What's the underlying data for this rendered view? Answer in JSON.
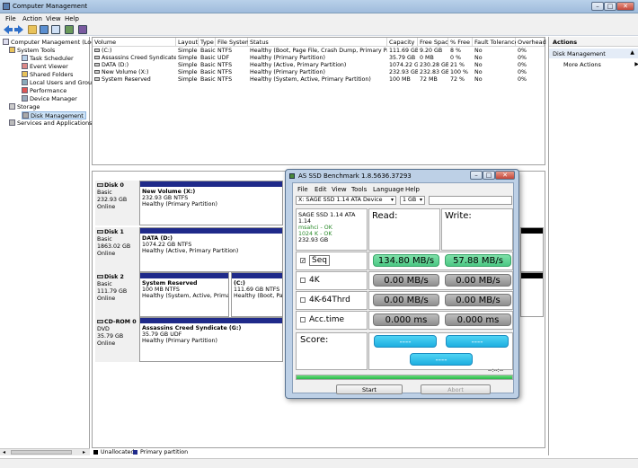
{
  "window": {
    "title": "Computer Management"
  },
  "menubar": [
    "File",
    "Action",
    "View",
    "Help"
  ],
  "tree": {
    "root": "Computer Management (Local",
    "items": [
      "System Tools",
      "Task Scheduler",
      "Event Viewer",
      "Shared Folders",
      "Local Users and Groups",
      "Performance",
      "Device Manager",
      "Storage",
      "Disk Management",
      "Services and Applications"
    ]
  },
  "volumes": {
    "columns": [
      "Volume",
      "Layout",
      "Type",
      "File System",
      "Status",
      "Capacity",
      "Free Space",
      "% Free",
      "Fault Tolerance",
      "Overhead"
    ],
    "rows": [
      [
        "(C:)",
        "Simple",
        "Basic",
        "NTFS",
        "Healthy (Boot, Page File, Crash Dump, Primary Partition)",
        "111.69 GB",
        "9.20 GB",
        "8 %",
        "No",
        "0%"
      ],
      [
        "Assassins Creed Syndicate (G:)",
        "Simple",
        "Basic",
        "UDF",
        "Healthy (Primary Partition)",
        "35.79 GB",
        "0 MB",
        "0 %",
        "No",
        "0%"
      ],
      [
        "DATA (D:)",
        "Simple",
        "Basic",
        "NTFS",
        "Healthy (Active, Primary Partition)",
        "1074.22 GB",
        "230.28 GB",
        "21 %",
        "No",
        "0%"
      ],
      [
        "New Volume (X:)",
        "Simple",
        "Basic",
        "NTFS",
        "Healthy (Primary Partition)",
        "232.93 GB",
        "232.83 GB",
        "100 %",
        "No",
        "0%"
      ],
      [
        "System Reserved",
        "Simple",
        "Basic",
        "NTFS",
        "Healthy (System, Active, Primary Partition)",
        "100 MB",
        "72 MB",
        "72 %",
        "No",
        "0%"
      ]
    ]
  },
  "disks": [
    {
      "name": "Disk 0",
      "type": "Basic",
      "size": "232.93 GB",
      "state": "Online",
      "vols": [
        {
          "name": "New Volume  (X:)",
          "size": "232.93 GB NTFS",
          "status": "Healthy (Primary Partition)"
        }
      ]
    },
    {
      "name": "Disk 1",
      "type": "Basic",
      "size": "1863.02 GB",
      "state": "Online",
      "vols": [
        {
          "name": "DATA  (D:)",
          "size": "1074.22 GB NTFS",
          "status": "Healthy (Active, Primary Partition)"
        }
      ]
    },
    {
      "name": "Disk 2",
      "type": "Basic",
      "size": "111.79 GB",
      "state": "Online",
      "vols": [
        {
          "name": "System Reserved",
          "size": "100 MB NTFS",
          "status": "Healthy (System, Active, Primary Pa"
        },
        {
          "name": "(C:)",
          "size": "111.69 GB NTFS",
          "status": "Healthy (Boot, Page Fi"
        }
      ]
    },
    {
      "name": "CD-ROM 0",
      "type": "DVD",
      "size": "35.79 GB",
      "state": "Online",
      "vols": [
        {
          "name": "Assassins Creed Syndicate  (G:)",
          "size": "35.79 GB UDF",
          "status": "Healthy (Primary Partition)"
        }
      ]
    }
  ],
  "legend": {
    "unallocated": "Unallocated",
    "primary": "Primary partition"
  },
  "actions": {
    "header": "Actions",
    "section": "Disk Management",
    "more": "More Actions"
  },
  "bench": {
    "title": "AS SSD Benchmark 1.8.5636.37293",
    "menu": [
      "File",
      "Edit",
      "View",
      "Tools",
      "Language",
      "Help"
    ],
    "device": "X: SAGE SSD 1.14 ATA Device",
    "size": "1 GB",
    "info": {
      "model": "SAGE SSD 1.14 ATA",
      "fw": "1.14",
      "driver": "msahci - OK",
      "align": "1024 K - OK",
      "cap": "232.93 GB"
    },
    "read_label": "Read:",
    "write_label": "Write:",
    "rows": [
      {
        "label": "Seq",
        "checked": true,
        "read": "134.80 MB/s",
        "write": "57.88 MB/s"
      },
      {
        "label": "4K",
        "checked": false,
        "read": "0.00 MB/s",
        "write": "0.00 MB/s"
      },
      {
        "label": "4K-64Thrd",
        "checked": false,
        "read": "0.00 MB/s",
        "write": "0.00 MB/s"
      },
      {
        "label": "Acc.time",
        "checked": false,
        "read": "0.000 ms",
        "write": "0.000 ms"
      }
    ],
    "score_label": "Score:",
    "score_read": "----",
    "score_write": "----",
    "score_total": "----",
    "progress_time": "--:--:--",
    "progress": 1.0,
    "start": "Start",
    "abort": "Abort"
  },
  "colors": {
    "primary_partition": "#1f2a8a",
    "green_pill": "#4cc884",
    "score_pill": "#1eaee0"
  }
}
